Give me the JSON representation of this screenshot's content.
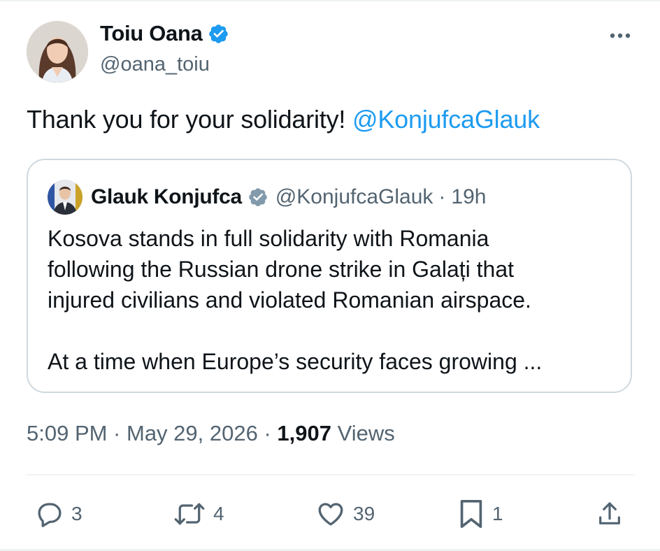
{
  "tweet": {
    "author": {
      "display_name": "Toiu Oana",
      "handle": "@oana_toiu",
      "avatar": "avatar-woman-photo",
      "verified_icon": "verified-badge-icon"
    },
    "text_before": "Thank you for your solidarity! ",
    "mention": "@KonjufcaGlauk",
    "quoted": {
      "author_name": "Glauk Konjufca",
      "handle": "@KonjufcaGlauk",
      "separator": "·",
      "time": "19h",
      "avatar": "avatar-man-photo",
      "verified_icon": "gray-verified-badge-icon",
      "lines": [
        "Kosova stands in full solidarity with Romania",
        "following the Russian drone strike in Galați that",
        "injured civilians and violated Romanian airspace."
      ],
      "second_paragraph": "At a time when Europe’s security faces growing ..."
    },
    "meta": {
      "time_date": "5:09 PM · May 29, 2026 · ",
      "views_count": "1,907",
      "views_label": " Views"
    },
    "actions": {
      "reply_count": "3",
      "retweet_count": "4",
      "like_count": "39",
      "bookmark_count": "1"
    }
  },
  "colors": {
    "accent": "#1d9bf0",
    "secondary_text": "#536471",
    "border": "#cfd9de",
    "verified_gray": "#829aab"
  },
  "icons": [
    "more-icon",
    "reply-icon",
    "retweet-icon",
    "like-icon",
    "bookmark-icon",
    "share-icon"
  ]
}
